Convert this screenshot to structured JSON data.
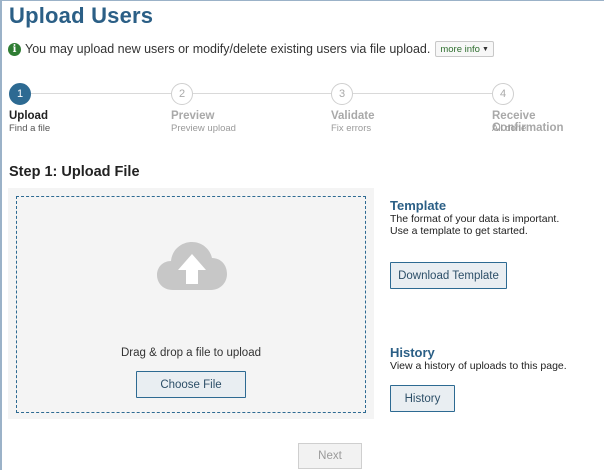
{
  "page": {
    "title": "Upload Users",
    "info_text": "You may upload new users or modify/delete existing users via file upload.",
    "more_info_label": "more info"
  },
  "steps": [
    {
      "number": "1",
      "name": "Upload",
      "subtitle": "Find a file",
      "state": "active"
    },
    {
      "number": "2",
      "name": "Preview",
      "subtitle": "Preview upload",
      "state": "inactive"
    },
    {
      "number": "3",
      "name": "Validate",
      "subtitle": "Fix errors",
      "state": "inactive"
    },
    {
      "number": "4",
      "name": "Receive Confirmation",
      "subtitle": "All done",
      "state": "inactive"
    }
  ],
  "upload": {
    "heading": "Step 1: Upload File",
    "drop_text": "Drag & drop a file to upload",
    "choose_label": "Choose File"
  },
  "template": {
    "heading": "Template",
    "text": "The format of your data is important. Use a template to get started.",
    "button_label": "Download Template"
  },
  "history": {
    "heading": "History",
    "text": "View a history of uploads to this page.",
    "button_label": "History"
  },
  "footer": {
    "next_label": "Next"
  },
  "colors": {
    "accent": "#2d6a92",
    "title": "#2b5f86",
    "info_icon": "#2f7d33"
  }
}
